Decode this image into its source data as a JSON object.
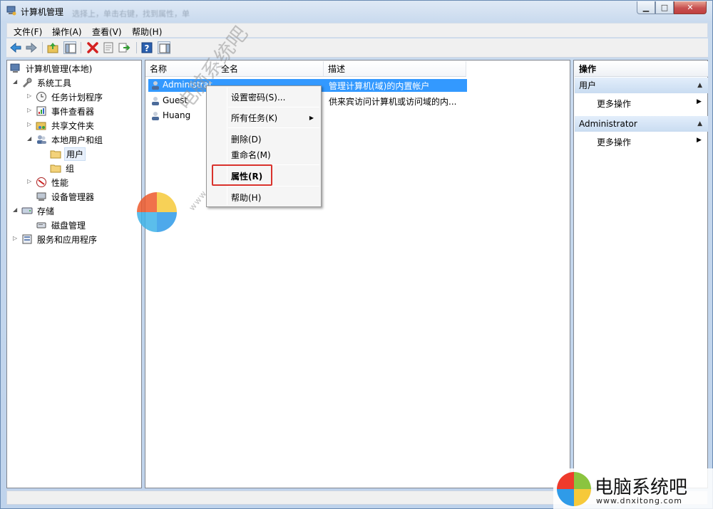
{
  "window": {
    "title": "计算机管理",
    "ghost_text": "选择上，单击右键，找到属性，单",
    "controls": {
      "minimize": "▁",
      "maximize": "□",
      "close": "✕"
    }
  },
  "menu": [
    "文件(F)",
    "操作(A)",
    "查看(V)",
    "帮助(H)"
  ],
  "toolbar_icons": [
    "back-icon",
    "forward-icon",
    "up-folder-icon",
    "show-tree-icon",
    "delete-icon",
    "properties-icon",
    "export-icon",
    "help-icon",
    "action-pane-icon"
  ],
  "tree": [
    {
      "label": "计算机管理(本地)",
      "icon": "computer-management-icon",
      "expander": ""
    },
    {
      "label": "系统工具",
      "icon": "tools-icon",
      "expander": "◢"
    },
    {
      "label": "任务计划程序",
      "icon": "clock-icon",
      "expander": "▷"
    },
    {
      "label": "事件查看器",
      "icon": "event-viewer-icon",
      "expander": "▷"
    },
    {
      "label": "共享文件夹",
      "icon": "shared-folder-icon",
      "expander": "▷"
    },
    {
      "label": "本地用户和组",
      "icon": "users-icon",
      "expander": "◢"
    },
    {
      "label": "用户",
      "icon": "folder-icon",
      "expander": ""
    },
    {
      "label": "组",
      "icon": "folder-icon",
      "expander": ""
    },
    {
      "label": "性能",
      "icon": "performance-icon",
      "expander": "▷"
    },
    {
      "label": "设备管理器",
      "icon": "device-manager-icon",
      "expander": ""
    },
    {
      "label": "存储",
      "icon": "storage-icon",
      "expander": "◢"
    },
    {
      "label": "磁盘管理",
      "icon": "disk-icon",
      "expander": ""
    },
    {
      "label": "服务和应用程序",
      "icon": "services-icon",
      "expander": "▷"
    }
  ],
  "list": {
    "columns": [
      "名称",
      "全名",
      "描述"
    ],
    "rows": [
      {
        "name": "Administrat",
        "fullname": "",
        "description": "管理计算机(域)的内置帐户",
        "selected": true
      },
      {
        "name": "Guest",
        "fullname": "",
        "description": "供来宾访问计算机或访问域的内...",
        "selected": false
      },
      {
        "name": "Huang",
        "fullname": "",
        "description": "",
        "selected": false
      }
    ]
  },
  "context_menu": {
    "set_password": "设置密码(S)...",
    "all_tasks": "所有任务(K)",
    "delete": "删除(D)",
    "rename": "重命名(M)",
    "properties": "属性(R)",
    "help": "帮助(H)",
    "submenu_arrow": "▶"
  },
  "actions": {
    "header": "操作",
    "group1": "用户",
    "group1_item": "更多操作",
    "group2": "Administrator",
    "group2_item": "更多操作",
    "collapse_glyph": "▲",
    "more_glyph": "▶"
  },
  "watermark": {
    "text": "电脑系统吧",
    "url": "www.dnxitong.com",
    "brand_text": "电脑系统吧",
    "brand_url": "www.dnxitong.com"
  },
  "colors": {
    "selection": "#3399ff",
    "highlight_box": "#d9322c",
    "window_chrome": "#c9daee"
  }
}
